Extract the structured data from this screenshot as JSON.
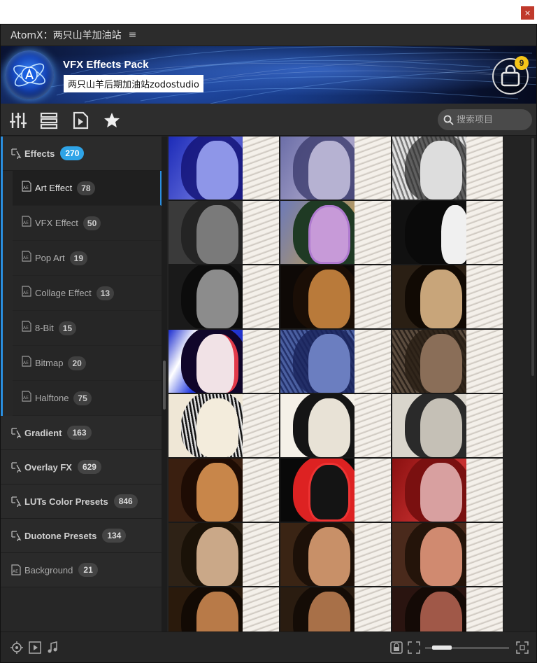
{
  "window": {
    "close_label": "×"
  },
  "panel": {
    "title": "AtomX：两只山羊加油站",
    "menu_icon": "hamburger-icon"
  },
  "banner": {
    "title": "VFX Effects Pack",
    "subtitle": "两只山羊后期加油站zodostudio",
    "cart_count": "9",
    "accent": "#2fa4e7",
    "badge_color": "#f5c518"
  },
  "toolbar": {
    "icons": [
      "sliders-icon",
      "list-view-icon",
      "video-file-icon",
      "star-icon"
    ],
    "search_placeholder": "搜索项目"
  },
  "sidebar": {
    "effects": {
      "label": "Effects",
      "count": "270"
    },
    "subitems": [
      {
        "label": "Art Effect",
        "count": "78",
        "active": true
      },
      {
        "label": "VFX Effect",
        "count": "50"
      },
      {
        "label": "Pop Art",
        "count": "19"
      },
      {
        "label": "Collage Effect",
        "count": "13"
      },
      {
        "label": "8-Bit",
        "count": "15"
      },
      {
        "label": "Bitmap",
        "count": "20"
      },
      {
        "label": "Halftone",
        "count": "75"
      }
    ],
    "categories": [
      {
        "label": "Gradient",
        "count": "163"
      },
      {
        "label": "Overlay FX",
        "count": "629"
      },
      {
        "label": "LUTs Color Presets",
        "count": "846"
      },
      {
        "label": "Duotone Presets",
        "count": "134"
      }
    ],
    "background": {
      "label": "Background",
      "count": "21"
    }
  },
  "footer": {
    "icons": [
      "locate-icon",
      "play-box-icon",
      "music-note-icon",
      "lock-screen-icon",
      "fit-icon",
      "fullscreen-icon"
    ]
  }
}
